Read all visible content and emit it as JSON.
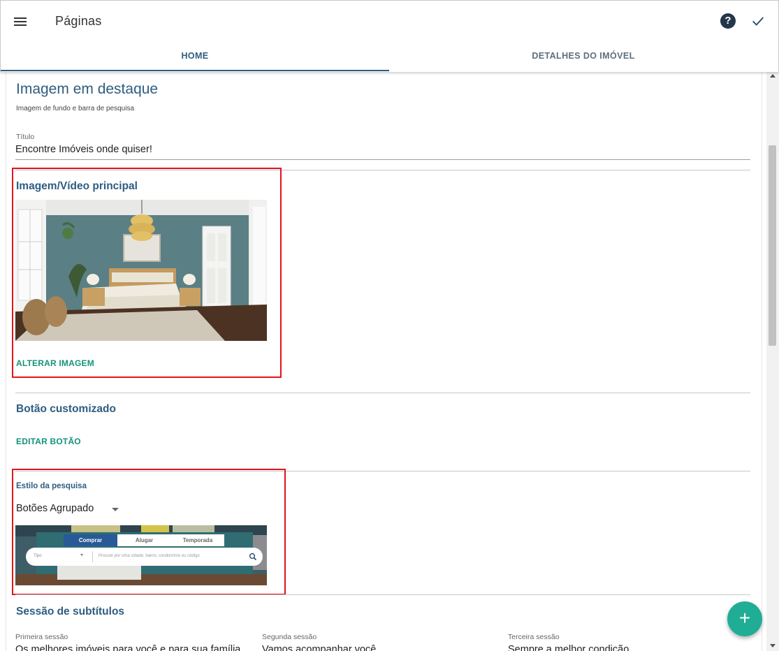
{
  "appbar": {
    "title": "Páginas",
    "menu_icon": "menu-icon",
    "help_icon": "help-icon",
    "help_glyph": "?",
    "confirm_icon": "check-icon"
  },
  "tabs": [
    {
      "label": "HOME",
      "active": true
    },
    {
      "label": "DETALHES DO IMÓVEL",
      "active": false
    }
  ],
  "hero": {
    "title": "Imagem em destaque",
    "subtitle": "Imagem de fundo e barra de pesquisa",
    "title_field": {
      "label": "Título",
      "value": "Encontre Imóveis onde quiser!"
    }
  },
  "media": {
    "title": "Imagem/Vídeo principal",
    "change_label": "ALTERAR IMAGEM"
  },
  "custom_button": {
    "title": "Botão customizado",
    "edit_label": "EDITAR BOTÃO"
  },
  "search_style": {
    "label": "Estilo da pesquisa",
    "value": "Botões Agrupado",
    "preview": {
      "tabs": [
        "Comprar",
        "Alugar",
        "Temporada"
      ],
      "type_placeholder": "Tipo",
      "search_placeholder": "Procure por uma cidade, bairro, condomínio ou código"
    }
  },
  "subtitles": {
    "title": "Sessão de subtítulos",
    "columns": [
      {
        "label": "Primeira sessão",
        "value": "Os melhores imóveis para você e para sua família"
      },
      {
        "label": "Segunda sessão",
        "value": "Vamos acompanhar você"
      },
      {
        "label": "Terceira sessão",
        "value": "Sempre a melhor condição"
      }
    ]
  },
  "fab": {
    "icon": "plus-icon",
    "glyph": "+"
  },
  "colors": {
    "primary": "#2e5d80",
    "accent": "#14937a",
    "fab": "#1fae95",
    "highlight": "#e0141b"
  }
}
